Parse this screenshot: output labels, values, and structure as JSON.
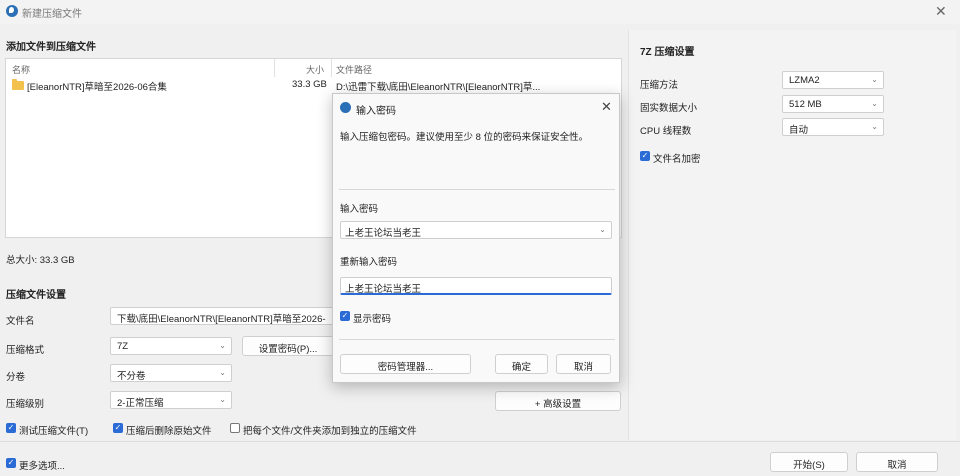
{
  "window": {
    "title": "新建压缩文件"
  },
  "files": {
    "section_title": "添加文件到压缩文件",
    "columns": {
      "name": "名称",
      "size": "大小",
      "path": "文件路径"
    },
    "rows": [
      {
        "name": "[EleanorNTR]草暗至2026-06合集",
        "size": "33.3 GB",
        "path": "D:\\迅雷下载\\底田\\EleanorNTR\\[EleanorNTR]草..."
      }
    ],
    "total": "总大小: 33.3 GB"
  },
  "settings": {
    "section_title": "压缩文件设置",
    "filename_label": "文件名",
    "filename_value": "下载\\底田\\EleanorNTR\\[EleanorNTR]草暗至2026-",
    "format_label": "压缩格式",
    "format_value": "7Z",
    "set_password_button": "设置密码(P)...",
    "split_label": "分卷",
    "split_value": "不分卷",
    "level_label": "压缩级别",
    "level_value": "2-正常压缩",
    "advanced_button": "+ 高级设置",
    "test_label": "测试压缩文件(T)",
    "delete_label": "压缩后删除原始文件",
    "each_label": "把每个文件/文件夹添加到独立的压缩文件"
  },
  "sevenz": {
    "section_title": "7Z 压缩设置",
    "method_label": "压缩方法",
    "method_value": "LZMA2",
    "dict_label": "固实数据大小",
    "dict_value": "512 MB",
    "threads_label": "CPU 线程数",
    "threads_value": "自动",
    "encrypt_names_label": "文件名加密"
  },
  "footer": {
    "more_options": "更多选项...",
    "start_button": "开始(S)",
    "cancel_button": "取消"
  },
  "dialog": {
    "title": "输入密码",
    "instruction": "输入压缩包密码。建议使用至少 8 位的密码来保证安全性。",
    "password_label": "输入密码",
    "password_value": "上老王论坛当老王",
    "confirm_label": "重新输入密码",
    "confirm_value": "上老王论坛当老王",
    "show_password_label": "显示密码",
    "manager_button": "密码管理器...",
    "ok_button": "确定",
    "cancel_button": "取消"
  }
}
